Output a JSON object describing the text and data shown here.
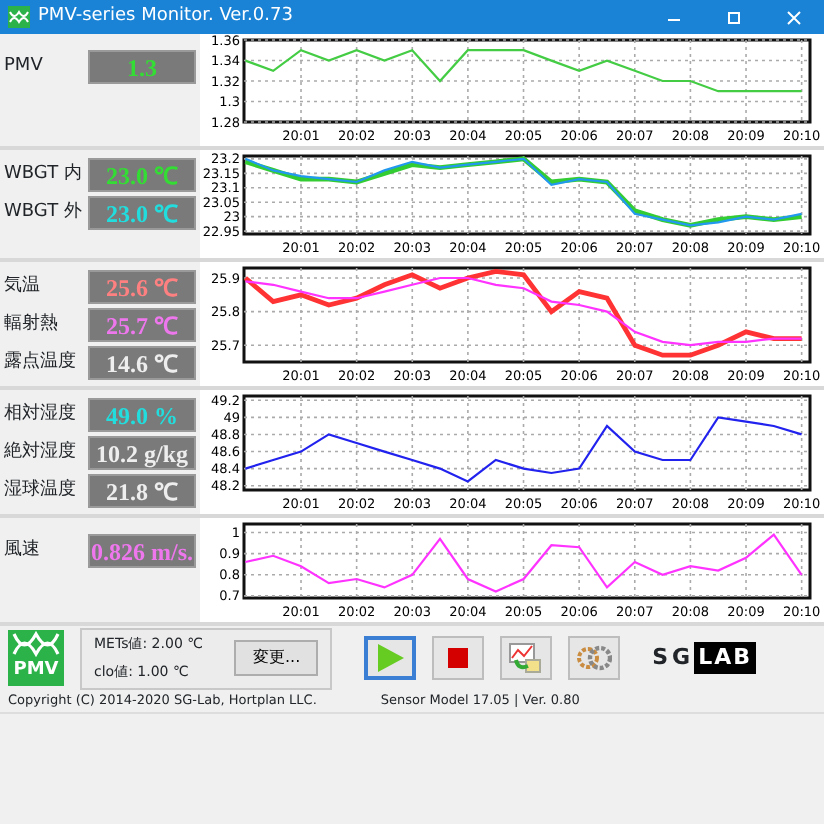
{
  "window": {
    "title": "PMV-series Monitor. Ver.0.73"
  },
  "panels": [
    {
      "readings": [
        {
          "label": "PMV",
          "value": "1.3",
          "color": "#33dd33"
        }
      ],
      "chart_data": {
        "type": "line",
        "categories": [
          null,
          null,
          "20:01",
          null,
          "20:02",
          null,
          "20:03",
          null,
          "20:04",
          null,
          "20:05",
          null,
          "20:06",
          null,
          "20:07",
          null,
          "20:08",
          null,
          "20:09",
          null,
          "20:10"
        ],
        "grid": true,
        "ylim": [
          1.28,
          1.36
        ],
        "yticks": [
          {
            "value": 1.28,
            "label": "1.28"
          },
          {
            "value": 1.3,
            "label": "1.3"
          },
          {
            "value": 1.32,
            "label": "1.32"
          },
          {
            "value": 1.34,
            "label": "1.34"
          },
          {
            "value": 1.36,
            "label": "1.36"
          }
        ],
        "series": [
          {
            "color": "#44cc44",
            "values": [
              1.34,
              1.33,
              1.35,
              1.34,
              1.35,
              1.34,
              1.35,
              1.32,
              1.35,
              1.35,
              1.35,
              1.34,
              1.33,
              1.34,
              1.33,
              1.32,
              1.32,
              1.31,
              1.31,
              1.31,
              1.31
            ]
          }
        ]
      }
    },
    {
      "readings": [
        {
          "label": "WBGT 内",
          "value": "23.0 ℃",
          "color": "#33dd33"
        },
        {
          "label": "WBGT 外",
          "value": "23.0 ℃",
          "color": "#22dddd"
        }
      ],
      "chart_data": {
        "type": "line",
        "categories": [
          null,
          null,
          "20:01",
          null,
          "20:02",
          null,
          "20:03",
          null,
          "20:04",
          null,
          "20:05",
          null,
          "20:06",
          null,
          "20:07",
          null,
          "20:08",
          null,
          "20:09",
          null,
          "20:10"
        ],
        "grid": true,
        "ylim": [
          22.94,
          23.21
        ],
        "yticks": [
          {
            "value": 22.95,
            "label": "22.95"
          },
          {
            "value": 23,
            "label": "23"
          },
          {
            "value": 23.05,
            "label": "23.05"
          },
          {
            "value": 23.1,
            "label": "23.1"
          },
          {
            "value": 23.15,
            "label": "23.15"
          },
          {
            "value": 23.2,
            "label": "23.2"
          }
        ],
        "series": [
          {
            "color": "#33cc33",
            "values": [
              23.19,
              23.16,
              23.13,
              23.13,
              23.12,
              23.15,
              23.18,
              23.17,
              23.18,
              23.19,
              23.2,
              23.12,
              23.13,
              23.12,
              23.02,
              22.99,
              22.97,
              22.99,
              23.0,
              22.99,
              23.0
            ]
          },
          {
            "color": "#2299ee",
            "values": [
              23.2,
              23.16,
              23.14,
              23.13,
              23.12,
              23.16,
              23.19,
              23.17,
              23.18,
              23.19,
              23.2,
              23.11,
              23.13,
              23.12,
              23.01,
              22.99,
              22.97,
              22.98,
              23.0,
              22.99,
              23.01
            ]
          }
        ]
      }
    },
    {
      "readings": [
        {
          "label": "気温",
          "value": "25.6 ℃",
          "color": "#ff8080"
        },
        {
          "label": "輻射熱",
          "value": "25.7 ℃",
          "color": "#ee77ee"
        },
        {
          "label": "露点温度",
          "value": "14.6 ℃",
          "color": "#eeeeee"
        }
      ],
      "chart_data": {
        "type": "line",
        "categories": [
          null,
          null,
          "20:01",
          null,
          "20:02",
          null,
          "20:03",
          null,
          "20:04",
          null,
          "20:05",
          null,
          "20:06",
          null,
          "20:07",
          null,
          "20:08",
          null,
          "20:09",
          null,
          "20:10"
        ],
        "grid": true,
        "ylim": [
          25.65,
          25.93
        ],
        "yticks": [
          {
            "value": 25.7,
            "label": "25.7"
          },
          {
            "value": 25.8,
            "label": "25.8"
          },
          {
            "value": 25.9,
            "label": "25.9"
          }
        ],
        "series": [
          {
            "color": "#ff3333",
            "values": [
              25.9,
              25.83,
              25.85,
              25.82,
              25.84,
              25.88,
              25.91,
              25.87,
              25.9,
              25.92,
              25.91,
              25.8,
              25.86,
              25.84,
              25.7,
              25.67,
              25.67,
              25.7,
              25.74,
              25.72,
              25.72
            ]
          },
          {
            "color": "#ff33ff",
            "values": [
              25.89,
              25.88,
              25.86,
              25.84,
              25.84,
              25.86,
              25.88,
              25.9,
              25.9,
              25.88,
              25.87,
              25.83,
              25.82,
              25.8,
              25.74,
              25.71,
              25.7,
              25.71,
              25.71,
              25.72,
              25.72
            ]
          }
        ]
      }
    },
    {
      "readings": [
        {
          "label": "相対湿度",
          "value": "49.0 %",
          "color": "#22dddd"
        },
        {
          "label": "絶対湿度",
          "value": "10.2 g/kg",
          "color": "#eeeeee"
        },
        {
          "label": "湿球温度",
          "value": "21.8 ℃",
          "color": "#eeeeee"
        }
      ],
      "chart_data": {
        "type": "line",
        "categories": [
          null,
          null,
          "20:01",
          null,
          "20:02",
          null,
          "20:03",
          null,
          "20:04",
          null,
          "20:05",
          null,
          "20:06",
          null,
          "20:07",
          null,
          "20:08",
          null,
          "20:09",
          null,
          "20:10"
        ],
        "grid": true,
        "ylim": [
          48.15,
          49.25
        ],
        "yticks": [
          {
            "value": 48.2,
            "label": "48.2"
          },
          {
            "value": 48.4,
            "label": "48.4"
          },
          {
            "value": 48.6,
            "label": "48.6"
          },
          {
            "value": 48.8,
            "label": "48.8"
          },
          {
            "value": 49,
            "label": "49"
          },
          {
            "value": 49.2,
            "label": "49.2"
          }
        ],
        "series": [
          {
            "color": "#2222ee",
            "values": [
              48.4,
              48.5,
              48.6,
              48.8,
              48.7,
              48.6,
              48.5,
              48.4,
              48.25,
              48.5,
              48.4,
              48.35,
              48.4,
              48.9,
              48.6,
              48.5,
              48.5,
              49.0,
              48.95,
              48.9,
              48.8
            ]
          }
        ]
      }
    },
    {
      "readings": [
        {
          "label": "風速",
          "value": "0.826 m/s.",
          "color": "#ee77ee"
        }
      ],
      "chart_data": {
        "type": "line",
        "categories": [
          null,
          null,
          "20:01",
          null,
          "20:02",
          null,
          "20:03",
          null,
          "20:04",
          null,
          "20:05",
          null,
          "20:06",
          null,
          "20:07",
          null,
          "20:08",
          null,
          "20:09",
          null,
          "20:10"
        ],
        "grid": true,
        "ylim": [
          0.69,
          1.04
        ],
        "yticks": [
          {
            "value": 0.7,
            "label": "0.7"
          },
          {
            "value": 0.8,
            "label": "0.8"
          },
          {
            "value": 0.9,
            "label": "0.9"
          },
          {
            "value": 1,
            "label": "1"
          }
        ],
        "series": [
          {
            "color": "#ff33ff",
            "values": [
              0.86,
              0.89,
              0.84,
              0.76,
              0.78,
              0.74,
              0.8,
              0.97,
              0.78,
              0.72,
              0.78,
              0.94,
              0.93,
              0.74,
              0.86,
              0.8,
              0.84,
              0.82,
              0.88,
              0.99,
              0.8
            ]
          }
        ]
      }
    }
  ],
  "settings": {
    "logo": "PMV",
    "lines": [
      "METs値: 2.00 ℃",
      "clo値: 1.00 ℃"
    ],
    "button": "変更..."
  },
  "controls": [
    {
      "kind": "play",
      "selected": true
    },
    {
      "kind": "stop",
      "selected": false
    },
    {
      "kind": "export",
      "selected": false
    },
    {
      "kind": "settings",
      "selected": false
    }
  ],
  "brand": {
    "left": "SG",
    "right": "LAB"
  },
  "status_bar": [
    "Copyright (C) 2014-2020 SG-Lab, Hortplan LLC.",
    "Sensor Model 17.05 | Ver. 0.80"
  ]
}
